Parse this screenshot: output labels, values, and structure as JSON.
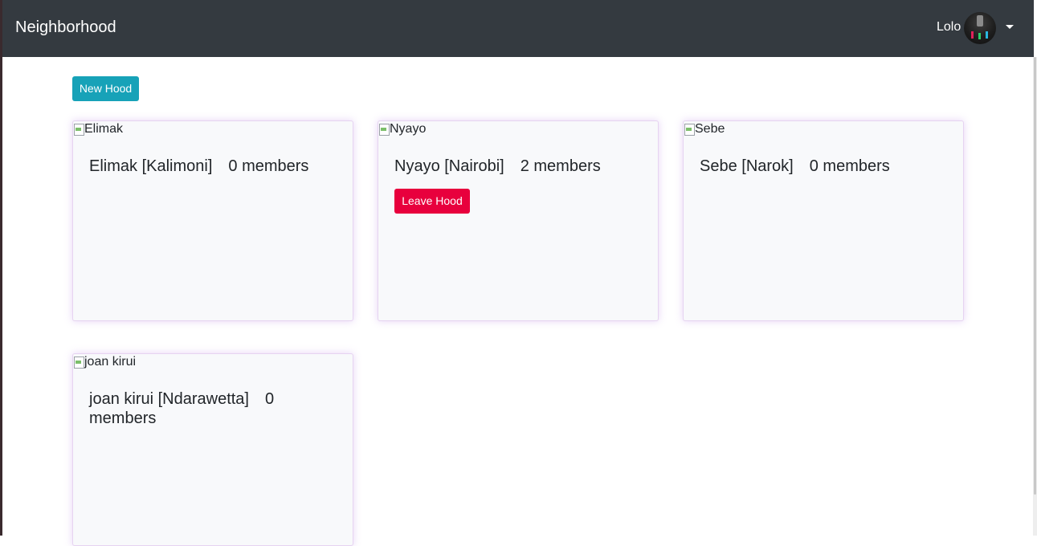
{
  "navbar": {
    "brand": "Neighborhood",
    "user_name": "Lolo",
    "avatar_icon": "user-avatar",
    "dropdown_icon": "caret-down-icon",
    "background": "#343a40"
  },
  "actions": {
    "new_hood_label": "New Hood",
    "new_hood_color": "#17a2b8"
  },
  "hoods": [
    {
      "image_alt": "Elimak",
      "name": "Elimak [Kalimoni]",
      "members": "0 members",
      "leave_label": ""
    },
    {
      "image_alt": "Nyayo",
      "name": "Nyayo [Nairobi]",
      "members": "2 members",
      "leave_label": "Leave Hood"
    },
    {
      "image_alt": "Sebe",
      "name": "Sebe [Narok]",
      "members": "0 members",
      "leave_label": ""
    },
    {
      "image_alt": "joan kirui",
      "name": "joan kirui [Ndarawetta]",
      "members": "0",
      "members_wrap": "members",
      "leave_label": ""
    }
  ],
  "colors": {
    "leave_button": "#e8003d",
    "card_border": "#e6d3f1"
  }
}
